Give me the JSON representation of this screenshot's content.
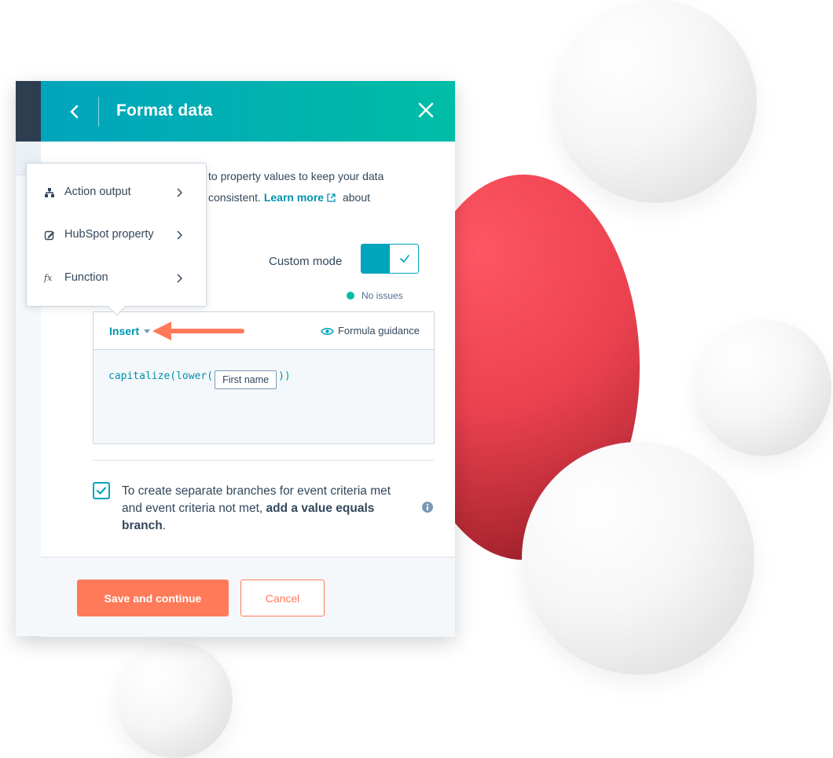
{
  "panel": {
    "title": "Format data"
  },
  "description": {
    "line1": "to property values to keep your data",
    "line2_prefix": "consistent.",
    "learn_more": "Learn more",
    "line2_suffix": "about"
  },
  "custom_mode": {
    "label": "Custom mode",
    "enabled": true
  },
  "status": {
    "text": "No issues",
    "color": "#00bda5"
  },
  "editor": {
    "insert_label": "Insert",
    "guidance_label": "Formula guidance",
    "formula_prefix": "capitalize(lower(",
    "formula_token": "First name",
    "formula_suffix": "))"
  },
  "dropdown": {
    "items": [
      {
        "label": "Action output",
        "icon": "hierarchy-icon"
      },
      {
        "label": "HubSpot property",
        "icon": "edit-icon"
      },
      {
        "label": "Function",
        "icon": "function-icon",
        "glyph": "fx"
      }
    ]
  },
  "branch_option": {
    "checked": true,
    "text": "To create separate branches for event criteria met and event criteria not met,",
    "bold": "add a value equals branch",
    "suffix": "."
  },
  "footer": {
    "save_label": "Save and continue",
    "cancel_label": "Cancel"
  },
  "colors": {
    "header_start": "#00a4bd",
    "header_end": "#00bda5",
    "primary_button": "#ff7a59",
    "link": "#0091ae",
    "accent_red": "#ec4250"
  }
}
